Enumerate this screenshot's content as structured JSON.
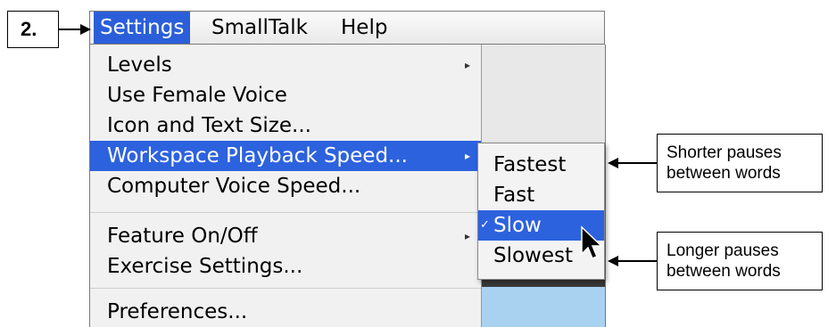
{
  "step_label": "2.",
  "menubar": {
    "items": [
      "Settings",
      "SmallTalk",
      "Help"
    ]
  },
  "settings_menu": {
    "items": [
      {
        "label": "Levels",
        "has_submenu": true
      },
      {
        "label": "Use Female Voice"
      },
      {
        "label": "Icon and Text Size..."
      },
      {
        "label": "Workspace Playback Speed...",
        "has_submenu": true,
        "highlighted": true
      },
      {
        "label": "Computer Voice Speed..."
      },
      {
        "label": "Feature On/Off",
        "has_submenu": true
      },
      {
        "label": "Exercise Settings..."
      },
      {
        "label": "Preferences..."
      }
    ]
  },
  "speed_submenu": {
    "items": [
      {
        "label": "Fastest"
      },
      {
        "label": "Fast"
      },
      {
        "label": "Slow",
        "checked": true,
        "highlighted": true
      },
      {
        "label": "Slowest"
      }
    ]
  },
  "callouts": {
    "top": {
      "line1": "Shorter pauses",
      "line2": "between words"
    },
    "bottom": {
      "line1": "Longer pauses",
      "line2": "between words"
    }
  },
  "colors": {
    "highlight": "#2d62de",
    "menu_bg": "#f1f1f1"
  },
  "icons": {
    "submenu_arrow": "triangle-right",
    "check": "checkmark",
    "cursor": "arrow-pointer"
  }
}
